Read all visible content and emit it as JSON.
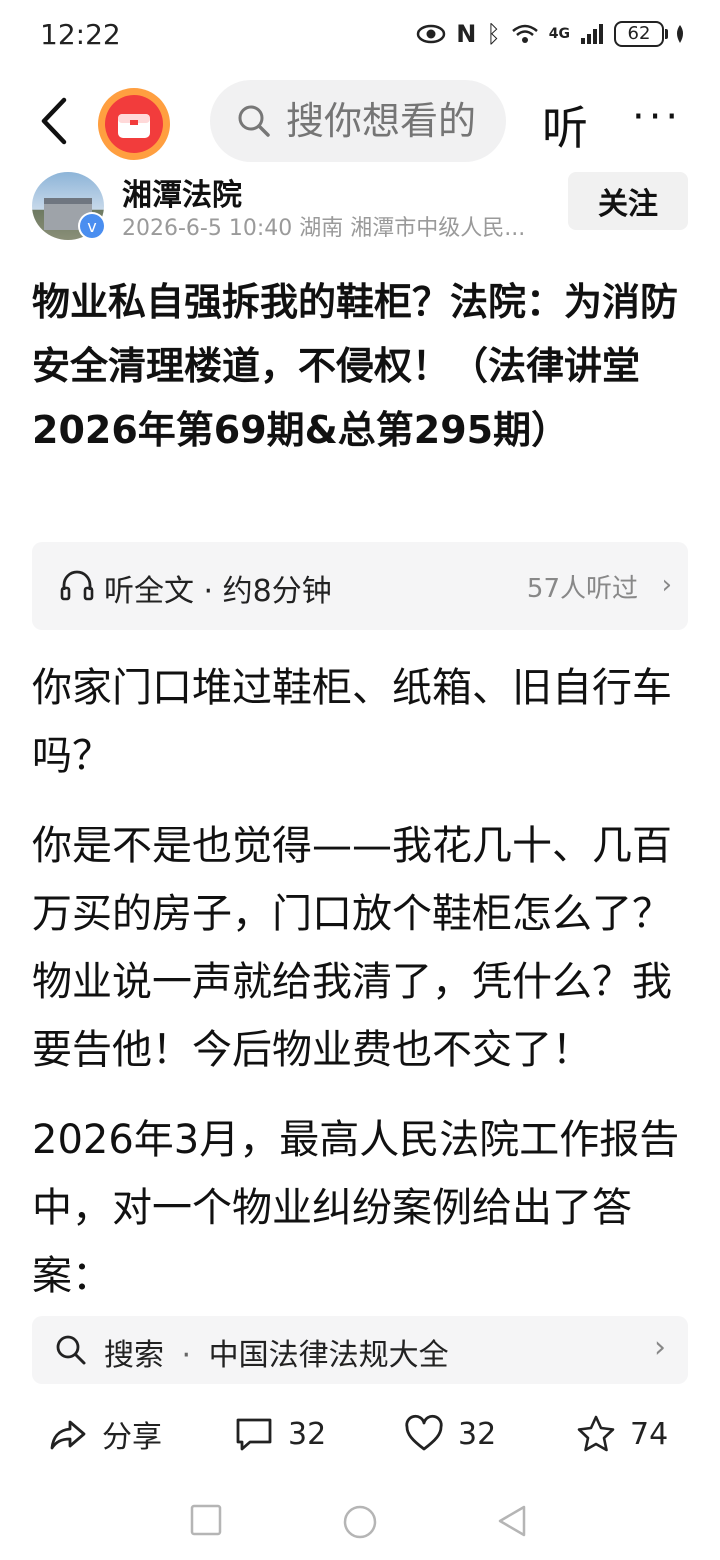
{
  "status": {
    "time": "12:22",
    "network": "4G",
    "battery": "62"
  },
  "topbar": {
    "search_placeholder": "搜你想看的",
    "listen_label": "听",
    "more_label": "···"
  },
  "author": {
    "name": "湘潭法院",
    "meta": "2026-6-5  10:40  湖南  湘潭市中级人民...",
    "follow_label": "关注",
    "verified_mark": "v"
  },
  "article": {
    "title": "物业私自强拆我的鞋柜？法院：为消防安全清理楼道，不侵权！（法律讲堂 2026年第69期&总第295期）",
    "audio_label": "听全文 · 约8分钟",
    "audio_listeners": "57人听过",
    "paragraphs": [
      "你家门口堆过鞋柜、纸箱、旧自行车吗？",
      "你是不是也觉得——我花几十、几百万买的房子，门口放个鞋柜怎么了？物业说一声就给我清了，凭什么？我要告他！今后物业费也不交了！",
      "2026年3月，最高人民法院工作报告中，对一个物业纠纷案例给出了答案："
    ]
  },
  "search_suggestion": {
    "prefix": "搜索",
    "separator": "·",
    "query": "中国法律法规大全"
  },
  "actions": {
    "share_label": "分享",
    "comment_count": "32",
    "like_count": "32",
    "favorite_count": "74"
  },
  "colors": {
    "accent_red": "#f23c3c",
    "verify_blue": "#4a8ef0",
    "muted_gray": "#9a9a9a"
  }
}
